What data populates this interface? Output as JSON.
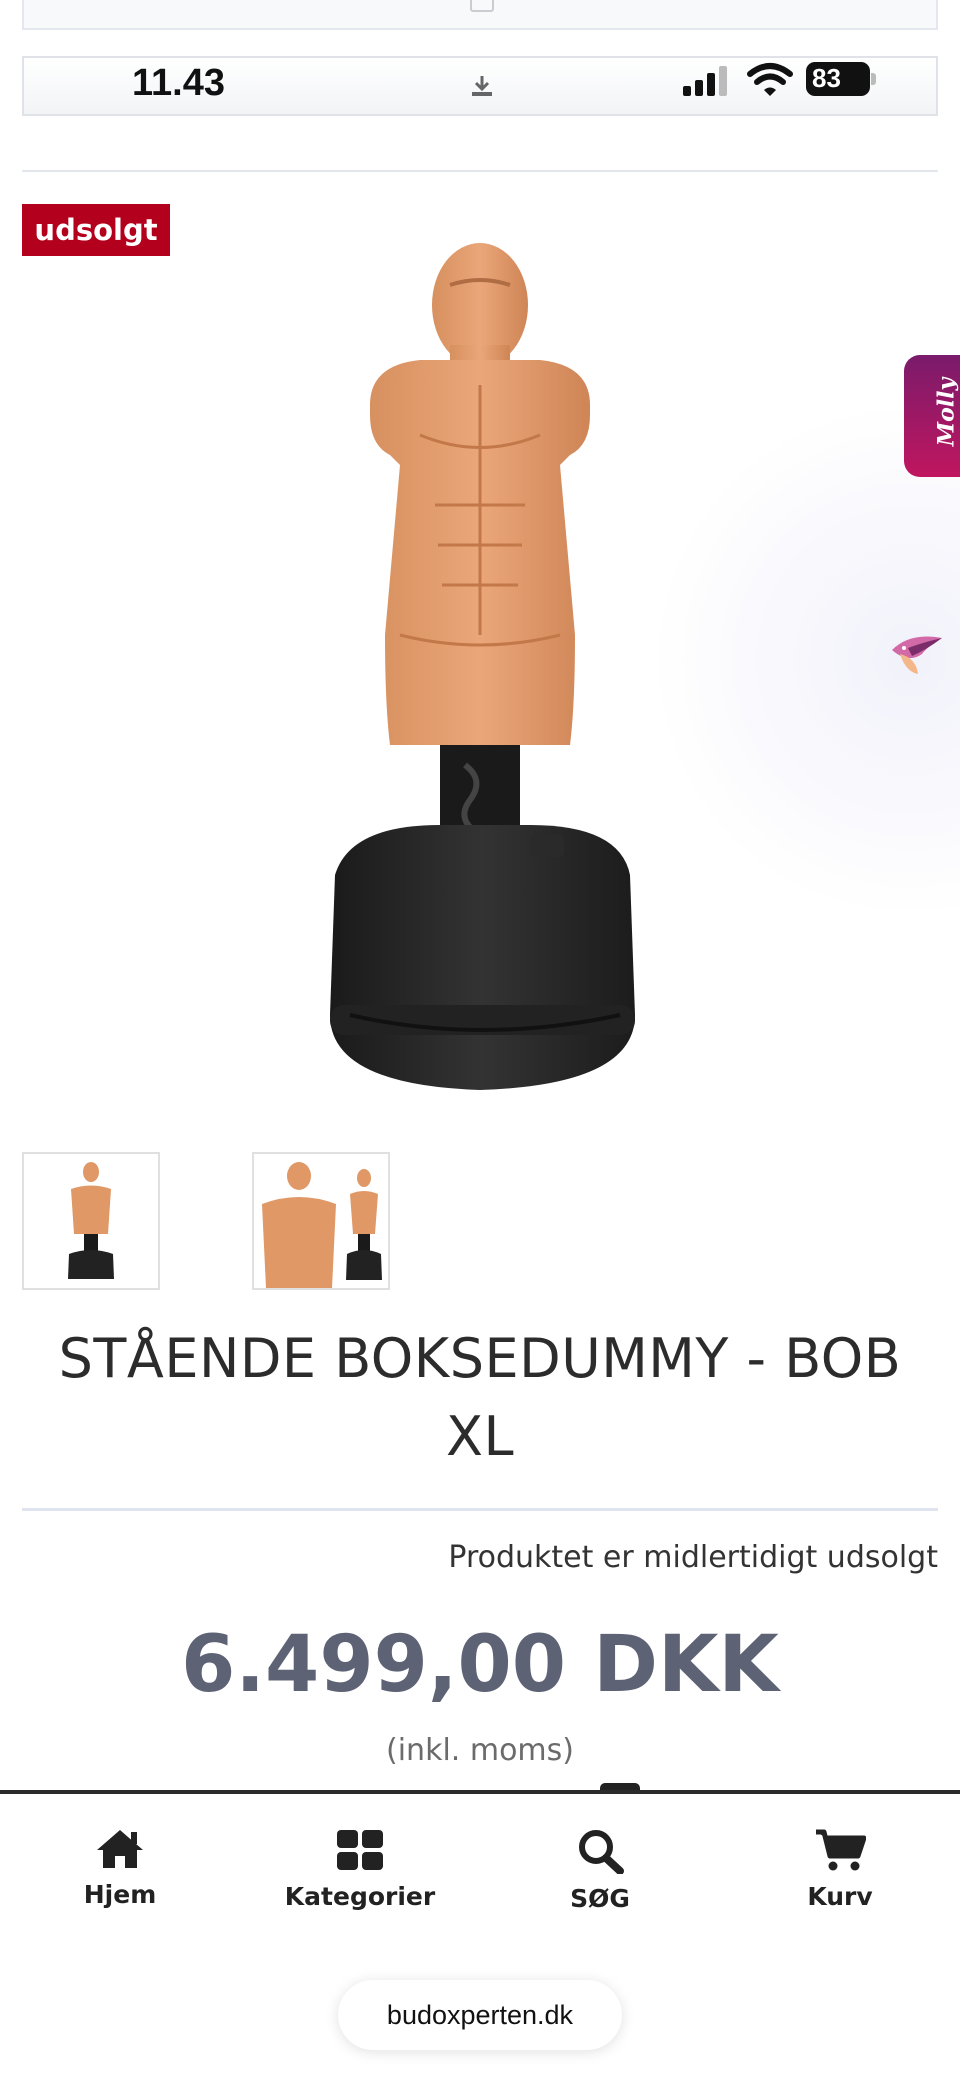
{
  "status_bar": {
    "time": "11.43",
    "battery": "83"
  },
  "product": {
    "badge": "udsolgt",
    "title": "STÅENDE BOKSEDUMMY - BOB XL",
    "stock_status": "Produktet er midlertidigt udsolgt",
    "price": "6.499,00 DKK",
    "vat_note": "(inkl. moms)"
  },
  "chat_widget": {
    "label": "Molly"
  },
  "bottom_nav": [
    {
      "label": "Hjem",
      "icon": "home-icon"
    },
    {
      "label": "Kategorier",
      "icon": "grid-icon"
    },
    {
      "label": "SØG",
      "icon": "search-icon"
    },
    {
      "label": "Kurv",
      "icon": "cart-icon"
    }
  ],
  "browser": {
    "url": "budoxperten.dk"
  }
}
